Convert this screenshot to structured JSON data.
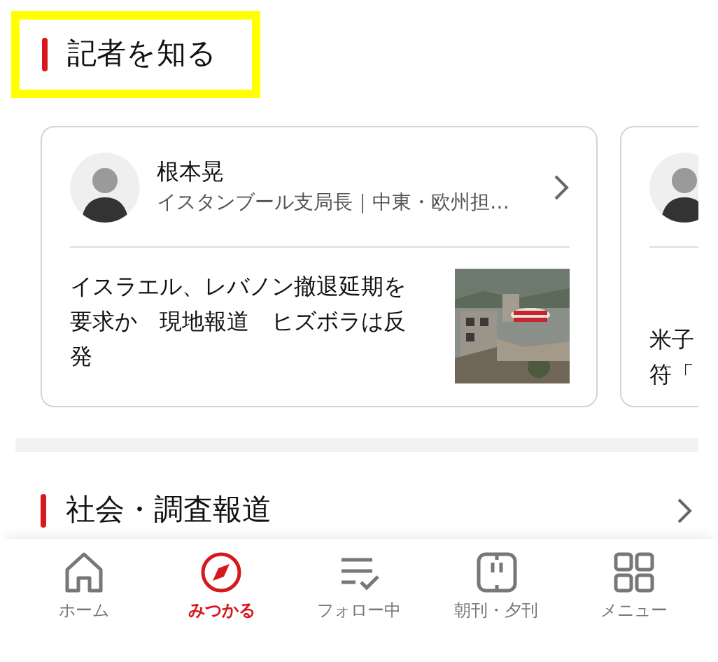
{
  "section_heading": {
    "title": "記者を知る",
    "highlighted": true
  },
  "reporters": [
    {
      "name": "根本晃",
      "role": "イスタンブール支局長｜中東・欧州担…",
      "article": "イスラエル、レバノン撤退延期を要求か　現地報道　ヒズボラは反発"
    },
    {
      "article_lines": [
        "米子",
        "符「"
      ]
    }
  ],
  "next_section": {
    "title": "社会・調査報道"
  },
  "bottom_nav": [
    {
      "label": "ホーム",
      "selected": false
    },
    {
      "label": "みつかる",
      "selected": true
    },
    {
      "label": "フォロー中",
      "selected": false
    },
    {
      "label": "朝刊・夕刊",
      "selected": false
    },
    {
      "label": "メニュー",
      "selected": false
    }
  ]
}
